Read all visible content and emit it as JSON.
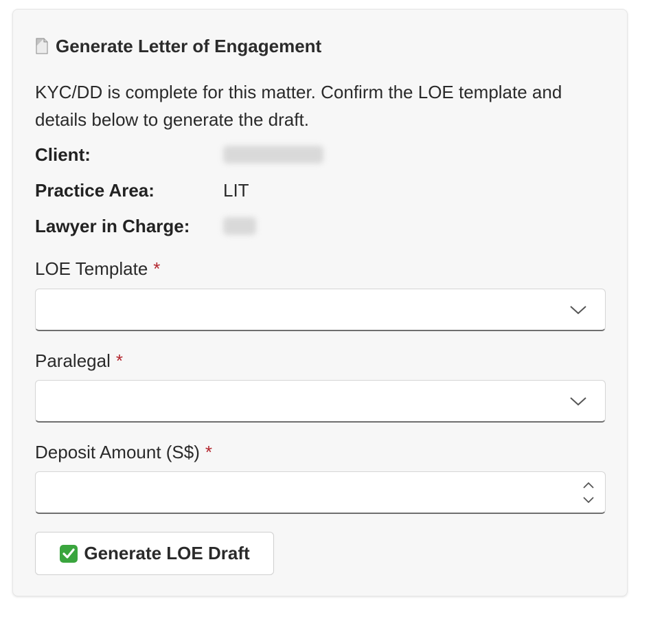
{
  "header": {
    "icon": "document-icon",
    "title": "Generate Letter of Engagement"
  },
  "description": "KYC/DD is complete for this matter. Confirm the LOE template and details below to generate the draft.",
  "info": {
    "client_label": "Client:",
    "practice_area_label": "Practice Area:",
    "practice_area_value": "LIT",
    "lawyer_label": "Lawyer in Charge:"
  },
  "form": {
    "loe_template": {
      "label": "LOE Template",
      "required_mark": "*",
      "value": ""
    },
    "paralegal": {
      "label": "Paralegal",
      "required_mark": "*",
      "value": ""
    },
    "deposit_amount": {
      "label": "Deposit Amount (S$)",
      "required_mark": "*",
      "value": ""
    }
  },
  "actions": {
    "generate_icon": "check-mark-icon",
    "generate_label": "Generate LOE Draft"
  },
  "colors": {
    "required": "#b3262e",
    "check_green": "#3aa53e",
    "card_background": "#f7f7f7"
  }
}
